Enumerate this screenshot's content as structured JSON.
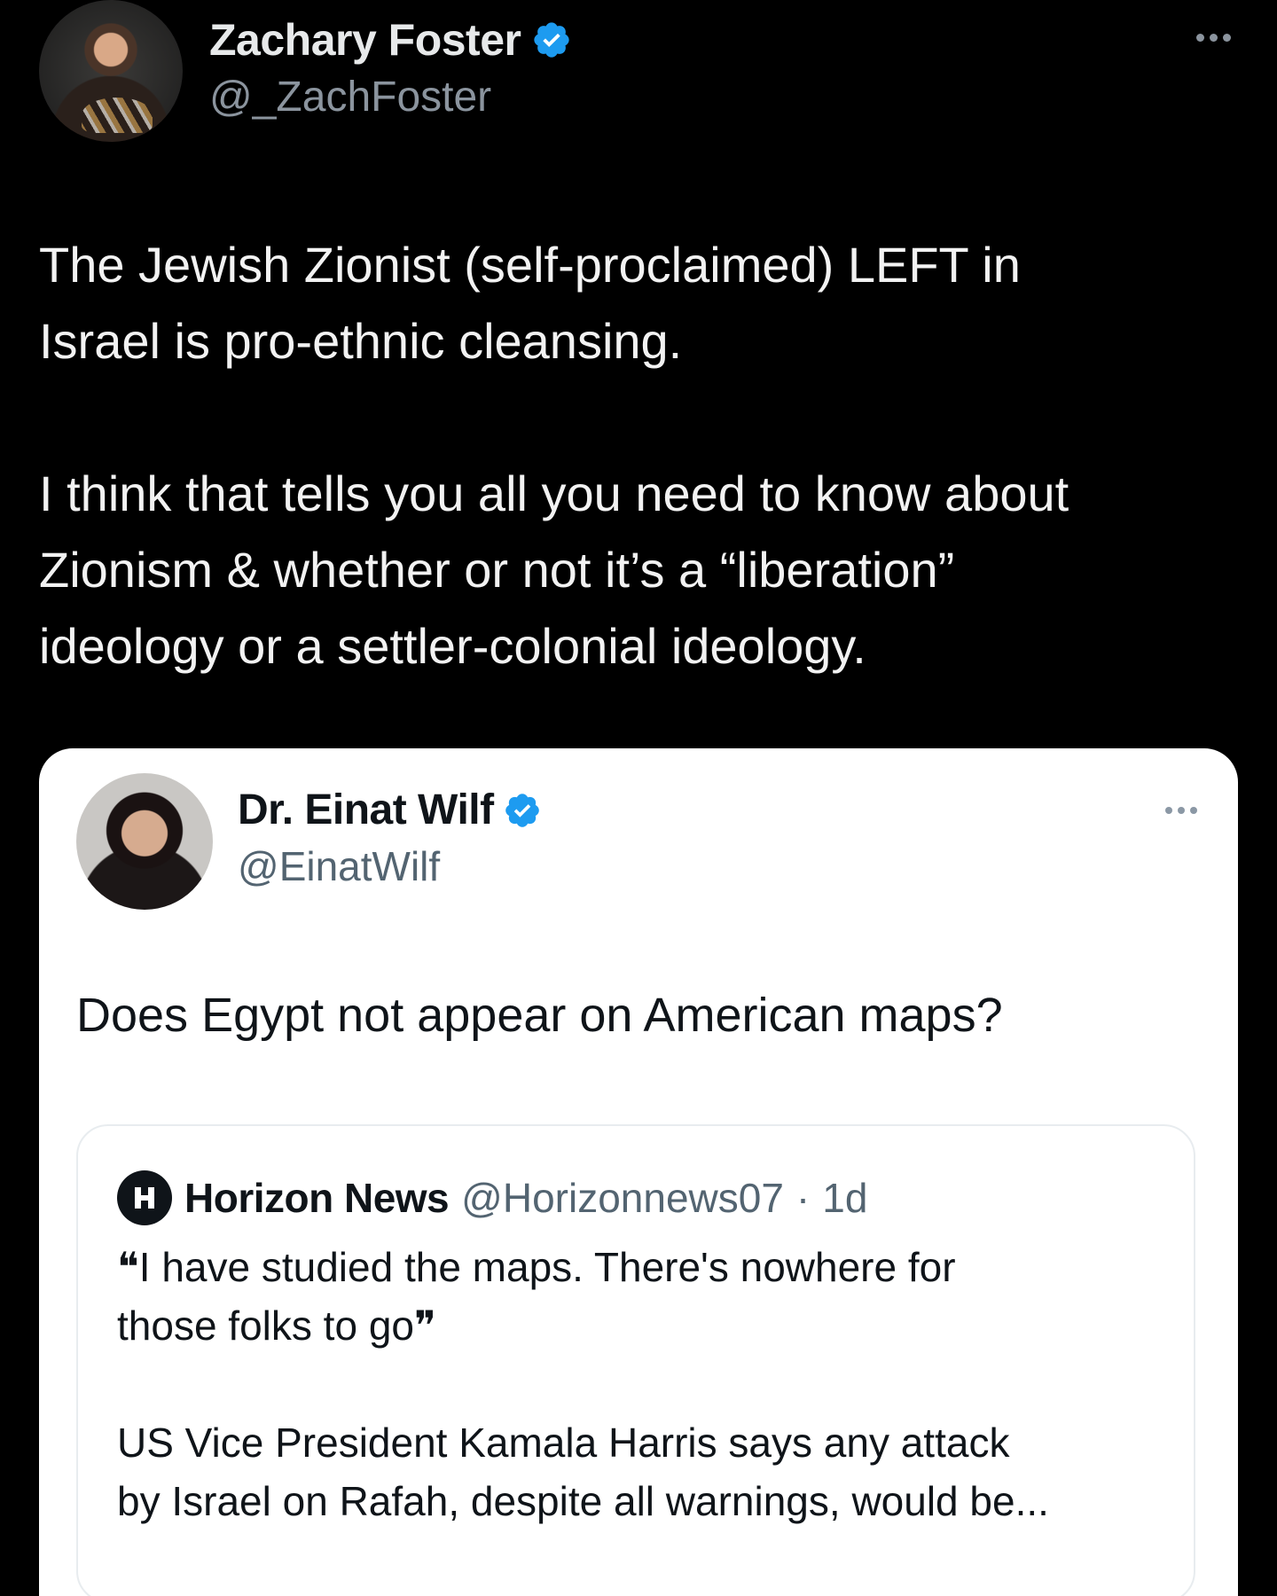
{
  "outer_tweet": {
    "author_name": "Zachary Foster",
    "handle": "@_ZachFoster",
    "text": "The Jewish Zionist (self-proclaimed) LEFT in\nIsrael is pro-ethnic cleansing.\n\nI think that tells you all you need to know about\nZionism & whether or not it’s a “liberation”\nideology or a settler-colonial ideology.",
    "verified": true
  },
  "quoted_tweet": {
    "author_name": "Dr. Einat Wilf",
    "handle": "@EinatWilf",
    "text": "Does Egypt not appear on American maps?",
    "verified": true
  },
  "nested_quote": {
    "author_name": "Horizon News",
    "handle": "@Horizonnews07",
    "separator": "·",
    "time": "1d",
    "text": "❝I have studied the maps. There's nowhere for\nthose folks to go❞\n\nUS Vice President Kamala Harris says any attack\nby Israel on Rafah, despite all warnings, would be..."
  },
  "colors": {
    "background": "#000000",
    "verified_blue": "#1d9bf0",
    "card_background": "#ffffff",
    "secondary_text_dark": "#8b949e",
    "secondary_text_light": "#536471"
  },
  "icons": {
    "verified": "verified-badge-icon",
    "more": "more-options-icon",
    "nested_logo": "horizon-news-logo-icon"
  }
}
